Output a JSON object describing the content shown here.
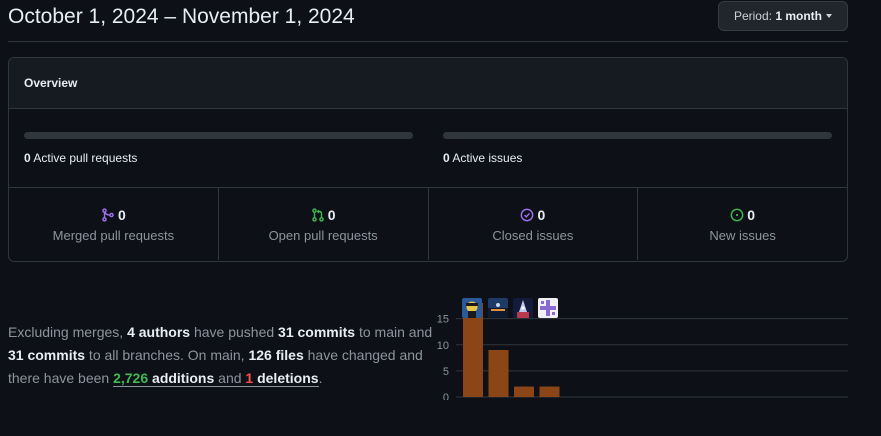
{
  "header": {
    "date_range": "October 1, 2024 – November 1, 2024",
    "period_prefix": "Period:",
    "period_value": "1 month"
  },
  "overview": {
    "title": "Overview",
    "active_prs_count": "0",
    "active_prs_label": "Active pull requests",
    "active_issues_count": "0",
    "active_issues_label": "Active issues",
    "stats": [
      {
        "count": "0",
        "label": "Merged pull requests",
        "icon": "git-merge-icon",
        "color": "#a371f7"
      },
      {
        "count": "0",
        "label": "Open pull requests",
        "icon": "git-pull-request-icon",
        "color": "#3fb950"
      },
      {
        "count": "0",
        "label": "Closed issues",
        "icon": "issue-closed-icon",
        "color": "#a371f7"
      },
      {
        "count": "0",
        "label": "New issues",
        "icon": "issue-opened-icon",
        "color": "#3fb950"
      }
    ]
  },
  "summary": {
    "t1": "Excluding merges, ",
    "authors": "4 authors",
    "t2": " have pushed ",
    "commits_main": "31 commits",
    "t3": " to main and ",
    "commits_all": "31 commits",
    "t4": " to all branches. On main, ",
    "files": "126 files",
    "t5": " have changed and there have been ",
    "additions_num": "2,726",
    "additions_word": "additions",
    "t6": " and ",
    "deletions_num": "1",
    "deletions_word": "deletions",
    "t7": "."
  },
  "chart_data": {
    "type": "bar",
    "categories": [
      "author 1",
      "author 2",
      "author 3",
      "author 4"
    ],
    "values": [
      18,
      9,
      2,
      2
    ],
    "yticks": [
      "0",
      "5",
      "10",
      "15"
    ],
    "ylim": [
      0,
      18
    ],
    "grid": true,
    "bar_color": "#8b4517"
  }
}
